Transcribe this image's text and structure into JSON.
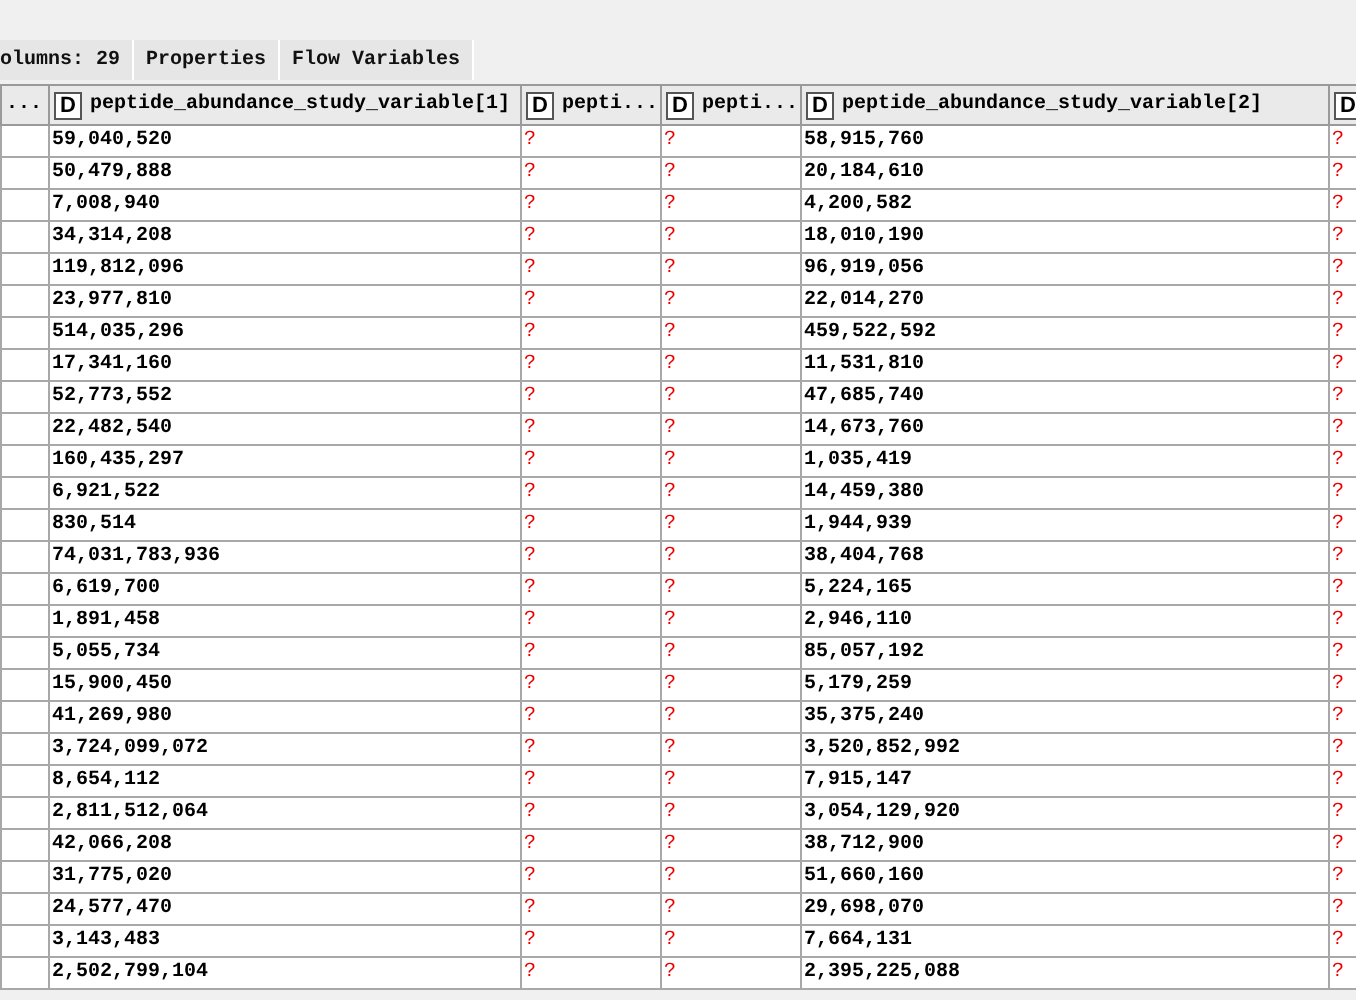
{
  "tabs": [
    {
      "label": "olumns: 29",
      "selected": false
    },
    {
      "label": "Properties",
      "selected": false
    },
    {
      "label": "Flow Variables",
      "selected": false
    }
  ],
  "table": {
    "columns": [
      {
        "name": "..."
      },
      {
        "type": "D",
        "name": "peptide_abundance_study_variable[1]"
      },
      {
        "type": "D",
        "name": "pepti..."
      },
      {
        "type": "D",
        "name": "pepti..."
      },
      {
        "type": "D",
        "name": "peptide_abundance_study_variable[2]"
      },
      {
        "type": "D"
      }
    ],
    "rows": [
      {
        "cells": [
          {
            "text": ""
          },
          {
            "text": "59,040,520",
            "missing": false
          },
          {
            "text": "?",
            "missing": true
          },
          {
            "text": "?",
            "missing": true
          },
          {
            "text": "58,915,760",
            "missing": false
          },
          {
            "text": "?",
            "missing": true
          }
        ]
      },
      {
        "cells": [
          {
            "text": ""
          },
          {
            "text": "50,479,888",
            "missing": false
          },
          {
            "text": "?",
            "missing": true
          },
          {
            "text": "?",
            "missing": true
          },
          {
            "text": "20,184,610",
            "missing": false
          },
          {
            "text": "?",
            "missing": true
          }
        ]
      },
      {
        "cells": [
          {
            "text": ""
          },
          {
            "text": "7,008,940",
            "missing": false
          },
          {
            "text": "?",
            "missing": true
          },
          {
            "text": "?",
            "missing": true
          },
          {
            "text": "4,200,582",
            "missing": false
          },
          {
            "text": "?",
            "missing": true
          }
        ]
      },
      {
        "cells": [
          {
            "text": ""
          },
          {
            "text": "34,314,208",
            "missing": false
          },
          {
            "text": "?",
            "missing": true
          },
          {
            "text": "?",
            "missing": true
          },
          {
            "text": "18,010,190",
            "missing": false
          },
          {
            "text": "?",
            "missing": true
          }
        ]
      },
      {
        "cells": [
          {
            "text": ""
          },
          {
            "text": "119,812,096",
            "missing": false
          },
          {
            "text": "?",
            "missing": true
          },
          {
            "text": "?",
            "missing": true
          },
          {
            "text": "96,919,056",
            "missing": false
          },
          {
            "text": "?",
            "missing": true
          }
        ]
      },
      {
        "cells": [
          {
            "text": ""
          },
          {
            "text": "23,977,810",
            "missing": false
          },
          {
            "text": "?",
            "missing": true
          },
          {
            "text": "?",
            "missing": true
          },
          {
            "text": "22,014,270",
            "missing": false
          },
          {
            "text": "?",
            "missing": true
          }
        ]
      },
      {
        "cells": [
          {
            "text": ""
          },
          {
            "text": "514,035,296",
            "missing": false
          },
          {
            "text": "?",
            "missing": true
          },
          {
            "text": "?",
            "missing": true
          },
          {
            "text": "459,522,592",
            "missing": false
          },
          {
            "text": "?",
            "missing": true
          }
        ]
      },
      {
        "cells": [
          {
            "text": ""
          },
          {
            "text": "17,341,160",
            "missing": false
          },
          {
            "text": "?",
            "missing": true
          },
          {
            "text": "?",
            "missing": true
          },
          {
            "text": "11,531,810",
            "missing": false
          },
          {
            "text": "?",
            "missing": true
          }
        ]
      },
      {
        "cells": [
          {
            "text": ""
          },
          {
            "text": "52,773,552",
            "missing": false
          },
          {
            "text": "?",
            "missing": true
          },
          {
            "text": "?",
            "missing": true
          },
          {
            "text": "47,685,740",
            "missing": false
          },
          {
            "text": "?",
            "missing": true
          }
        ]
      },
      {
        "cells": [
          {
            "text": ""
          },
          {
            "text": "22,482,540",
            "missing": false
          },
          {
            "text": "?",
            "missing": true
          },
          {
            "text": "?",
            "missing": true
          },
          {
            "text": "14,673,760",
            "missing": false
          },
          {
            "text": "?",
            "missing": true
          }
        ]
      },
      {
        "cells": [
          {
            "text": ""
          },
          {
            "text": "160,435,297",
            "missing": false
          },
          {
            "text": "?",
            "missing": true
          },
          {
            "text": "?",
            "missing": true
          },
          {
            "text": "1,035,419",
            "missing": false
          },
          {
            "text": "?",
            "missing": true
          }
        ]
      },
      {
        "cells": [
          {
            "text": ""
          },
          {
            "text": "6,921,522",
            "missing": false
          },
          {
            "text": "?",
            "missing": true
          },
          {
            "text": "?",
            "missing": true
          },
          {
            "text": "14,459,380",
            "missing": false
          },
          {
            "text": "?",
            "missing": true
          }
        ]
      },
      {
        "cells": [
          {
            "text": ""
          },
          {
            "text": "830,514",
            "missing": false
          },
          {
            "text": "?",
            "missing": true
          },
          {
            "text": "?",
            "missing": true
          },
          {
            "text": "1,944,939",
            "missing": false
          },
          {
            "text": "?",
            "missing": true
          }
        ]
      },
      {
        "cells": [
          {
            "text": ""
          },
          {
            "text": "74,031,783,936",
            "missing": false
          },
          {
            "text": "?",
            "missing": true
          },
          {
            "text": "?",
            "missing": true
          },
          {
            "text": "38,404,768",
            "missing": false
          },
          {
            "text": "?",
            "missing": true
          }
        ]
      },
      {
        "cells": [
          {
            "text": ""
          },
          {
            "text": "6,619,700",
            "missing": false
          },
          {
            "text": "?",
            "missing": true
          },
          {
            "text": "?",
            "missing": true
          },
          {
            "text": "5,224,165",
            "missing": false
          },
          {
            "text": "?",
            "missing": true
          }
        ]
      },
      {
        "cells": [
          {
            "text": ""
          },
          {
            "text": "1,891,458",
            "missing": false
          },
          {
            "text": "?",
            "missing": true
          },
          {
            "text": "?",
            "missing": true
          },
          {
            "text": "2,946,110",
            "missing": false
          },
          {
            "text": "?",
            "missing": true
          }
        ]
      },
      {
        "cells": [
          {
            "text": ""
          },
          {
            "text": "5,055,734",
            "missing": false
          },
          {
            "text": "?",
            "missing": true
          },
          {
            "text": "?",
            "missing": true
          },
          {
            "text": "85,057,192",
            "missing": false
          },
          {
            "text": "?",
            "missing": true
          }
        ]
      },
      {
        "cells": [
          {
            "text": ""
          },
          {
            "text": "15,900,450",
            "missing": false
          },
          {
            "text": "?",
            "missing": true
          },
          {
            "text": "?",
            "missing": true
          },
          {
            "text": "5,179,259",
            "missing": false
          },
          {
            "text": "?",
            "missing": true
          }
        ]
      },
      {
        "cells": [
          {
            "text": ""
          },
          {
            "text": "41,269,980",
            "missing": false
          },
          {
            "text": "?",
            "missing": true
          },
          {
            "text": "?",
            "missing": true
          },
          {
            "text": "35,375,240",
            "missing": false
          },
          {
            "text": "?",
            "missing": true
          }
        ]
      },
      {
        "cells": [
          {
            "text": ""
          },
          {
            "text": "3,724,099,072",
            "missing": false
          },
          {
            "text": "?",
            "missing": true
          },
          {
            "text": "?",
            "missing": true
          },
          {
            "text": "3,520,852,992",
            "missing": false
          },
          {
            "text": "?",
            "missing": true
          }
        ]
      },
      {
        "cells": [
          {
            "text": ""
          },
          {
            "text": "8,654,112",
            "missing": false
          },
          {
            "text": "?",
            "missing": true
          },
          {
            "text": "?",
            "missing": true
          },
          {
            "text": "7,915,147",
            "missing": false
          },
          {
            "text": "?",
            "missing": true
          }
        ]
      },
      {
        "cells": [
          {
            "text": ""
          },
          {
            "text": "2,811,512,064",
            "missing": false
          },
          {
            "text": "?",
            "missing": true
          },
          {
            "text": "?",
            "missing": true
          },
          {
            "text": "3,054,129,920",
            "missing": false
          },
          {
            "text": "?",
            "missing": true
          }
        ]
      },
      {
        "cells": [
          {
            "text": ""
          },
          {
            "text": "42,066,208",
            "missing": false
          },
          {
            "text": "?",
            "missing": true
          },
          {
            "text": "?",
            "missing": true
          },
          {
            "text": "38,712,900",
            "missing": false
          },
          {
            "text": "?",
            "missing": true
          }
        ]
      },
      {
        "cells": [
          {
            "text": ""
          },
          {
            "text": "31,775,020",
            "missing": false
          },
          {
            "text": "?",
            "missing": true
          },
          {
            "text": "?",
            "missing": true
          },
          {
            "text": "51,660,160",
            "missing": false
          },
          {
            "text": "?",
            "missing": true
          }
        ]
      },
      {
        "cells": [
          {
            "text": ""
          },
          {
            "text": "24,577,470",
            "missing": false
          },
          {
            "text": "?",
            "missing": true
          },
          {
            "text": "?",
            "missing": true
          },
          {
            "text": "29,698,070",
            "missing": false
          },
          {
            "text": "?",
            "missing": true
          }
        ]
      },
      {
        "cells": [
          {
            "text": ""
          },
          {
            "text": "3,143,483",
            "missing": false
          },
          {
            "text": "?",
            "missing": true
          },
          {
            "text": "?",
            "missing": true
          },
          {
            "text": "7,664,131",
            "missing": false
          },
          {
            "text": "?",
            "missing": true
          }
        ]
      },
      {
        "cells": [
          {
            "text": ""
          },
          {
            "text": "2,502,799,104",
            "missing": false
          },
          {
            "text": "?",
            "missing": true
          },
          {
            "text": "?",
            "missing": true
          },
          {
            "text": "2,395,225,088",
            "missing": false
          },
          {
            "text": "?",
            "missing": true
          }
        ]
      }
    ]
  }
}
